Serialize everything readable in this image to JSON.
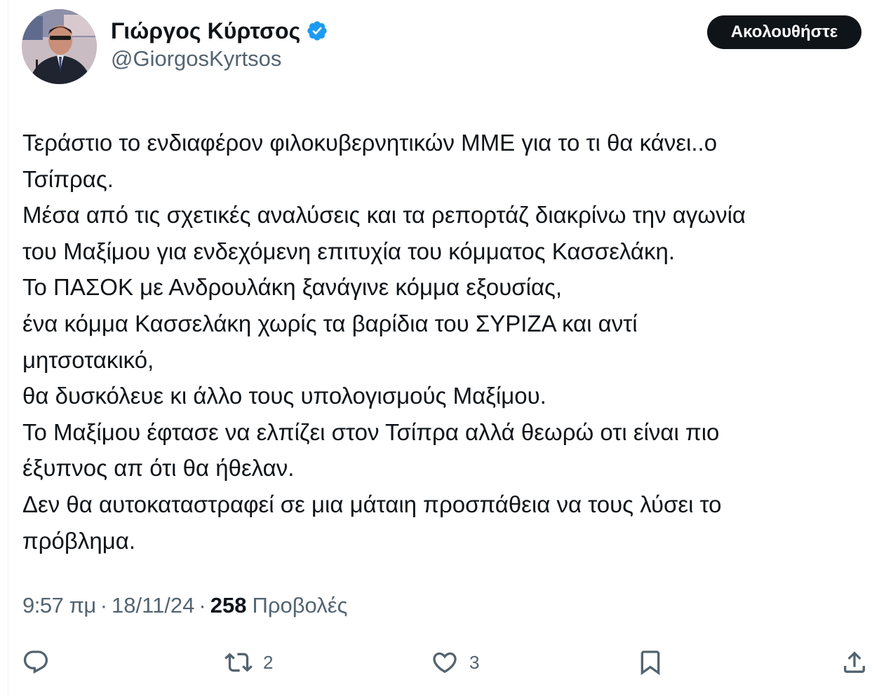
{
  "author": {
    "display_name": "Γιώργος Κύρτσος",
    "handle": "@GiorgosKyrtsos",
    "verified": true,
    "verified_color": "#1d9bf0"
  },
  "follow_button": {
    "label": "Ακολουθήστε"
  },
  "tweet": {
    "lines": [
      "Τεράστιο το ενδιαφέρον φιλοκυβερνητικών ΜΜΕ για το τι θα κάνει..ο",
      "Τσίπρας.",
      "Μέσα από τις σχετικές αναλύσεις και τα ρεπορτάζ διακρίνω την αγωνία",
      "του Μαξίμου για ενδεχόμενη επιτυχία του κόμματος Κασσελάκη.",
      "Το ΠΑΣΟΚ με Ανδρουλάκη ξανάγινε κόμμα εξουσίας,",
      "ένα κόμμα Κασσελάκη χωρίς τα βαρίδια του ΣΥΡΙΖΑ και αντί",
      "μητσοτακικό,",
      "θα δυσκόλευε κι άλλο τους υπολογισμούς Μαξίμου.",
      "Το Μαξίμου έφτασε να ελπίζει στον Τσίπρα αλλά θεωρώ οτι είναι πιο",
      "έξυπνος απ ότι θα ήθελαν.",
      "Δεν θα αυτοκαταστραφεί σε μια μάταιη προσπάθεια να τους λύσει το",
      "πρόβλημα."
    ]
  },
  "meta": {
    "time": "9:57 πμ",
    "separator": "·",
    "date": "18/11/24",
    "views_count": "258",
    "views_label": "Προβολές"
  },
  "actions": {
    "reply": {
      "icon": "reply-icon",
      "count": ""
    },
    "repost": {
      "icon": "repost-icon",
      "count": "2"
    },
    "like": {
      "icon": "heart-icon",
      "count": "3"
    },
    "bookmark": {
      "icon": "bookmark-icon",
      "count": ""
    },
    "share": {
      "icon": "share-icon",
      "count": ""
    }
  },
  "colors": {
    "text": "#0f1419",
    "secondary": "#536471",
    "button_bg": "#0f1419",
    "button_text": "#ffffff"
  }
}
